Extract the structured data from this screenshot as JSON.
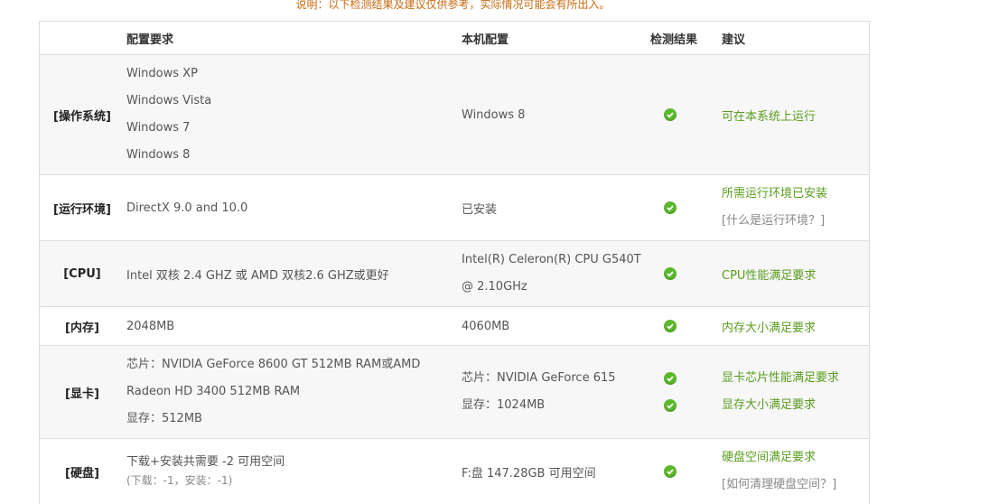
{
  "note": "说明：以下检测结果及建议仅供参考，实际情况可能会有所出入。",
  "header": {
    "requirement": "配置要求",
    "local": "本机配置",
    "result": "检测结果",
    "advice": "建议"
  },
  "rows": {
    "os": {
      "label": "[操作系统]",
      "requirements": [
        "Windows XP",
        "Windows Vista",
        "Windows 7",
        "Windows 8"
      ],
      "local": "Windows 8",
      "advice": "可在本系统上运行"
    },
    "runtime": {
      "label": "[运行环境]",
      "requirement": "DirectX 9.0 and 10.0",
      "local": "已安装",
      "advice": "所需运行环境已安装",
      "help_link": "[什么是运行环境？]"
    },
    "cpu": {
      "label": "[CPU]",
      "requirement": "Intel 双核  2.4 GHZ 或  AMD 双核2.6 GHZ或更好",
      "local_lines": [
        "Intel(R) Celeron(R) CPU G540T",
        "@ 2.10GHz"
      ],
      "advice": "CPU性能满足要求"
    },
    "memory": {
      "label": "[内存]",
      "requirement": "2048MB",
      "local": "4060MB",
      "advice": "内存大小满足要求"
    },
    "gpu": {
      "label": "[显卡]",
      "requirement_lines": [
        "芯片：NVIDIA GeForce 8600 GT 512MB RAM或AMD",
        "Radeon HD 3400 512MB RAM",
        "显存：512MB"
      ],
      "local_lines": [
        "芯片：NVIDIA GeForce 615",
        "显存：1024MB"
      ],
      "advice_lines": [
        "显卡芯片性能满足要求",
        "显存大小满足要求"
      ]
    },
    "disk": {
      "label": "[硬盘]",
      "requirement": "下载+安装共需要  -2 可用空间",
      "requirement_sub": "(下载：-1，安装：-1)",
      "local": "F:盘  147.28GB 可用空间",
      "advice": "硬盘空间满足要求",
      "help_link": "[如何清理硬盘空间？]"
    }
  },
  "icons": {
    "pass": "check-circle-icon"
  },
  "colors": {
    "pass": "#5cb82d",
    "advice": "#5a9c1f",
    "note": "#c8690f"
  }
}
